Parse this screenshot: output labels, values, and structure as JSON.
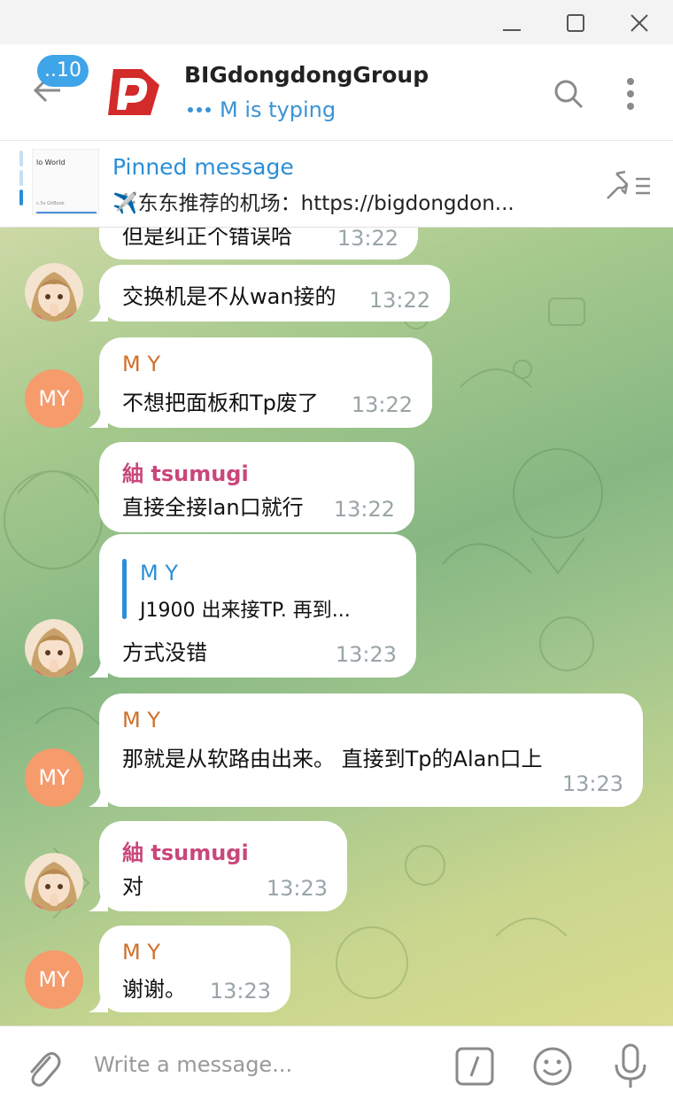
{
  "window": {
    "controls": [
      "minimize-icon",
      "maximize-icon",
      "close-icon"
    ]
  },
  "header": {
    "unread_badge": "..10",
    "title": "BIGdongdongGroup",
    "status": "M is typing",
    "accent": "#3a93d6"
  },
  "pinned": {
    "label": "Pinned message",
    "text": "✈️东东推荐的机场：https://bigdongdon...",
    "thumb_title": "lo World",
    "thumb_sub": "c.5x GitBook"
  },
  "messages": [
    {
      "sender": "",
      "text": "但是纠正个错误哈",
      "time": "13:22"
    },
    {
      "sender": "",
      "text": "交换机是不从wan接的",
      "time": "13:22"
    },
    {
      "sender": "M Y",
      "avatar": "MY",
      "text": "不想把面板和Tp废了",
      "time": "13:22"
    },
    {
      "sender": "紬 tsumugi",
      "text": "直接全接lan口就行",
      "time": "13:22"
    },
    {
      "sender": "",
      "reply_to": {
        "name": "M Y",
        "text": "J1900 出来接TP. 再到..."
      },
      "text": "方式没错",
      "time": "13:23"
    },
    {
      "sender": "M Y",
      "avatar": "MY",
      "text": "那就是从软路由出来。 直接到Tp的Alan口上",
      "time": "13:23"
    },
    {
      "sender": "紬 tsumugi",
      "text": "对",
      "time": "13:23"
    },
    {
      "sender": "M Y",
      "avatar": "MY",
      "text": "谢谢。",
      "time": "13:23"
    }
  ],
  "composer": {
    "placeholder": "Write a message..."
  },
  "colors": {
    "my_name": "#cf6f2b",
    "tsumugi_name": "#c9477a",
    "my_avatar": "#f59b6c",
    "badge": "#3fa4e8"
  }
}
